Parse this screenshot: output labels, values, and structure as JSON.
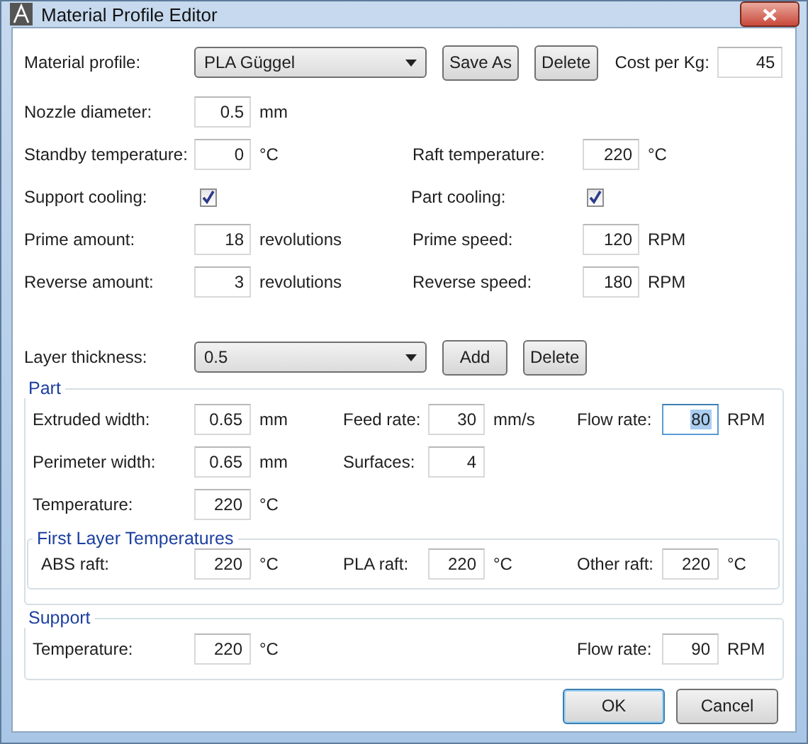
{
  "window": {
    "title": "Material Profile Editor"
  },
  "profile": {
    "label": "Material profile:",
    "value": "PLA Güggel",
    "buttons": [
      "Save As",
      "Delete"
    ],
    "cost_label": "Cost per Kg:",
    "cost_value": "45"
  },
  "general_rows": [
    [
      {
        "kind": "number",
        "label": "Nozzle diameter:",
        "value": "0.5",
        "unit": "mm"
      }
    ],
    [
      {
        "kind": "number",
        "label": "Standby temperature:",
        "value": "0",
        "unit": "°C"
      },
      {
        "kind": "number",
        "label": "Raft temperature:",
        "value": "220",
        "unit": "°C"
      }
    ],
    [
      {
        "kind": "checkbox",
        "label": "Support cooling:",
        "checked": true
      },
      {
        "kind": "checkbox",
        "label": "Part cooling:",
        "checked": true
      }
    ],
    [
      {
        "kind": "number",
        "label": "Prime amount:",
        "value": "18",
        "unit": "revolutions"
      },
      {
        "kind": "number",
        "label": "Prime speed:",
        "value": "120",
        "unit": "RPM"
      }
    ],
    [
      {
        "kind": "number",
        "label": "Reverse amount:",
        "value": "3",
        "unit": "revolutions"
      },
      {
        "kind": "number",
        "label": "Reverse speed:",
        "value": "180",
        "unit": "RPM"
      }
    ]
  ],
  "layer": {
    "label": "Layer thickness:",
    "value": "0.5",
    "buttons": [
      "Add",
      "Delete"
    ]
  },
  "part": {
    "title": "Part",
    "rows": [
      [
        {
          "label": "Extruded width:",
          "value": "0.65",
          "unit": "mm",
          "focused": false
        },
        {
          "label": "Feed rate:",
          "value": "30",
          "unit": "mm/s",
          "focused": false
        },
        {
          "label": "Flow rate:",
          "value": "80",
          "unit": "RPM",
          "focused": true
        }
      ],
      [
        {
          "label": "Perimeter width:",
          "value": "0.65",
          "unit": "mm",
          "focused": false
        },
        {
          "label": "Surfaces:",
          "value": "4",
          "focused": false
        }
      ],
      [
        {
          "label": "Temperature:",
          "value": "220",
          "unit": "°C",
          "focused": false
        }
      ]
    ],
    "first_layer": {
      "title": "First Layer Temperatures",
      "fields": [
        {
          "label": "ABS raft:",
          "value": "220",
          "unit": "°C"
        },
        {
          "label": "PLA raft:",
          "value": "220",
          "unit": "°C"
        },
        {
          "label": "Other raft:",
          "value": "220",
          "unit": "°C"
        }
      ]
    }
  },
  "support": {
    "title": "Support",
    "fields": [
      {
        "label": "Temperature:",
        "value": "220",
        "unit": "°C"
      },
      {
        "label": "Flow rate:",
        "value": "90",
        "unit": "RPM"
      }
    ]
  },
  "buttons": [
    {
      "label": "OK",
      "default": true
    },
    {
      "label": "Cancel",
      "default": false
    }
  ]
}
